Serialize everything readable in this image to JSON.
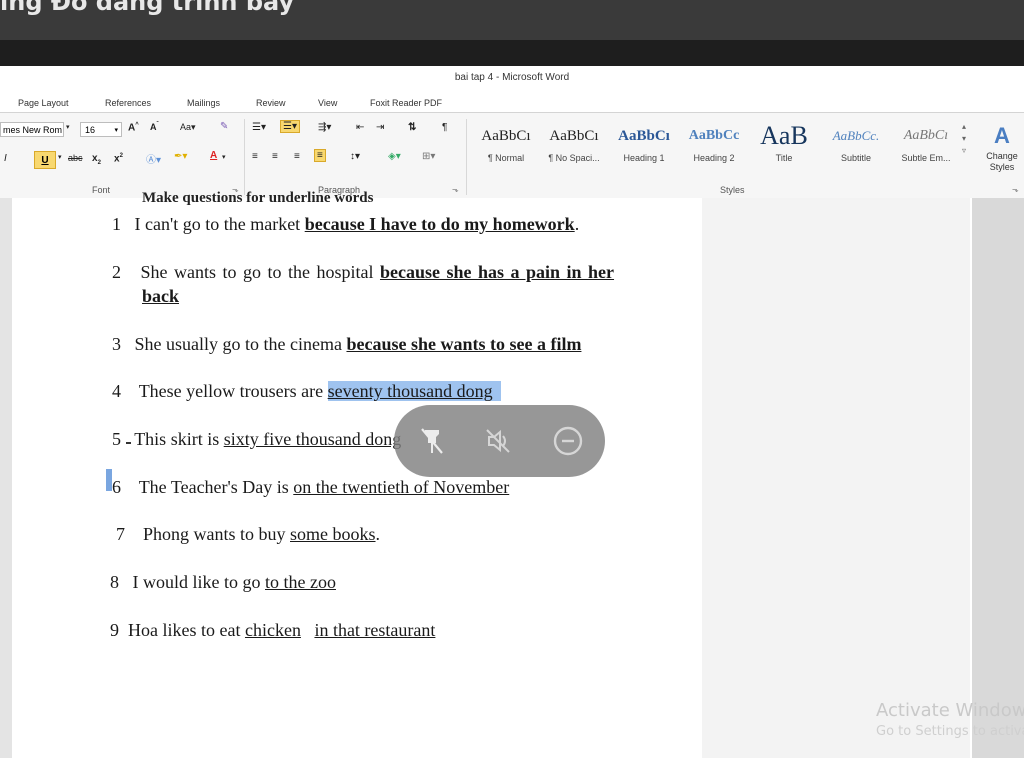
{
  "window": {
    "top_title": "ing Đó đang trình bày",
    "app_title": "bai tap 4  -  Microsoft Word"
  },
  "menu": [
    "Page Layout",
    "References",
    "Mailings",
    "Review",
    "View",
    "Foxit Reader PDF"
  ],
  "ribbon": {
    "font_name": "mes New Rom",
    "font_size": "16",
    "font_group": "Font",
    "paragraph_group": "Paragraph",
    "styles_group": "Styles",
    "styles": [
      {
        "preview": "AaBbCı",
        "name": "¶ Normal"
      },
      {
        "preview": "AaBbCı",
        "name": "¶ No Spaci..."
      },
      {
        "preview": "AaBbCı",
        "name": "Heading 1"
      },
      {
        "preview": "AaBbCc",
        "name": "Heading 2"
      },
      {
        "preview": "AaB",
        "name": "Title"
      },
      {
        "preview": "AaBbCc.",
        "name": "Subtitle"
      },
      {
        "preview": "AaBbCı",
        "name": "Subtle Em..."
      }
    ],
    "change_styles": "Change Styles"
  },
  "document": {
    "heading": "Make questions for underline words",
    "items": [
      {
        "n": "1",
        "pre": "I can't go to the market ",
        "u": "because I have to do my homework",
        "post": "."
      },
      {
        "n": "2",
        "pre": "She wants to go to the hospital ",
        "u": "because she has a pain in her",
        "u2": "back"
      },
      {
        "n": "3",
        "pre": "She usually go to the cinema ",
        "u": "because she wants to see a film"
      },
      {
        "n": "4",
        "pre": "These yellow trousers are ",
        "u": "seventy thousand dong"
      },
      {
        "n": "5",
        "pre": "This skirt is ",
        "u": "sixty five thousand dong"
      },
      {
        "n": "6",
        "pre": "The Teacher's Day is ",
        "u": "on the twentieth of November"
      },
      {
        "n": "7",
        "pre": "Phong wants to buy ",
        "u": "some books",
        "post": "."
      },
      {
        "n": "8",
        "pre": "I would like to go ",
        "u": "to the zoo"
      },
      {
        "n": "9",
        "pre": "Hoa likes to eat ",
        "u": "chicken",
        "u2": "in that restaurant"
      }
    ]
  },
  "watermark": {
    "line1": "Activate Windows",
    "line2": "Go to Settings to activate"
  },
  "overlay_icons": [
    "unpin-icon",
    "mute-icon",
    "minimize-icon"
  ]
}
